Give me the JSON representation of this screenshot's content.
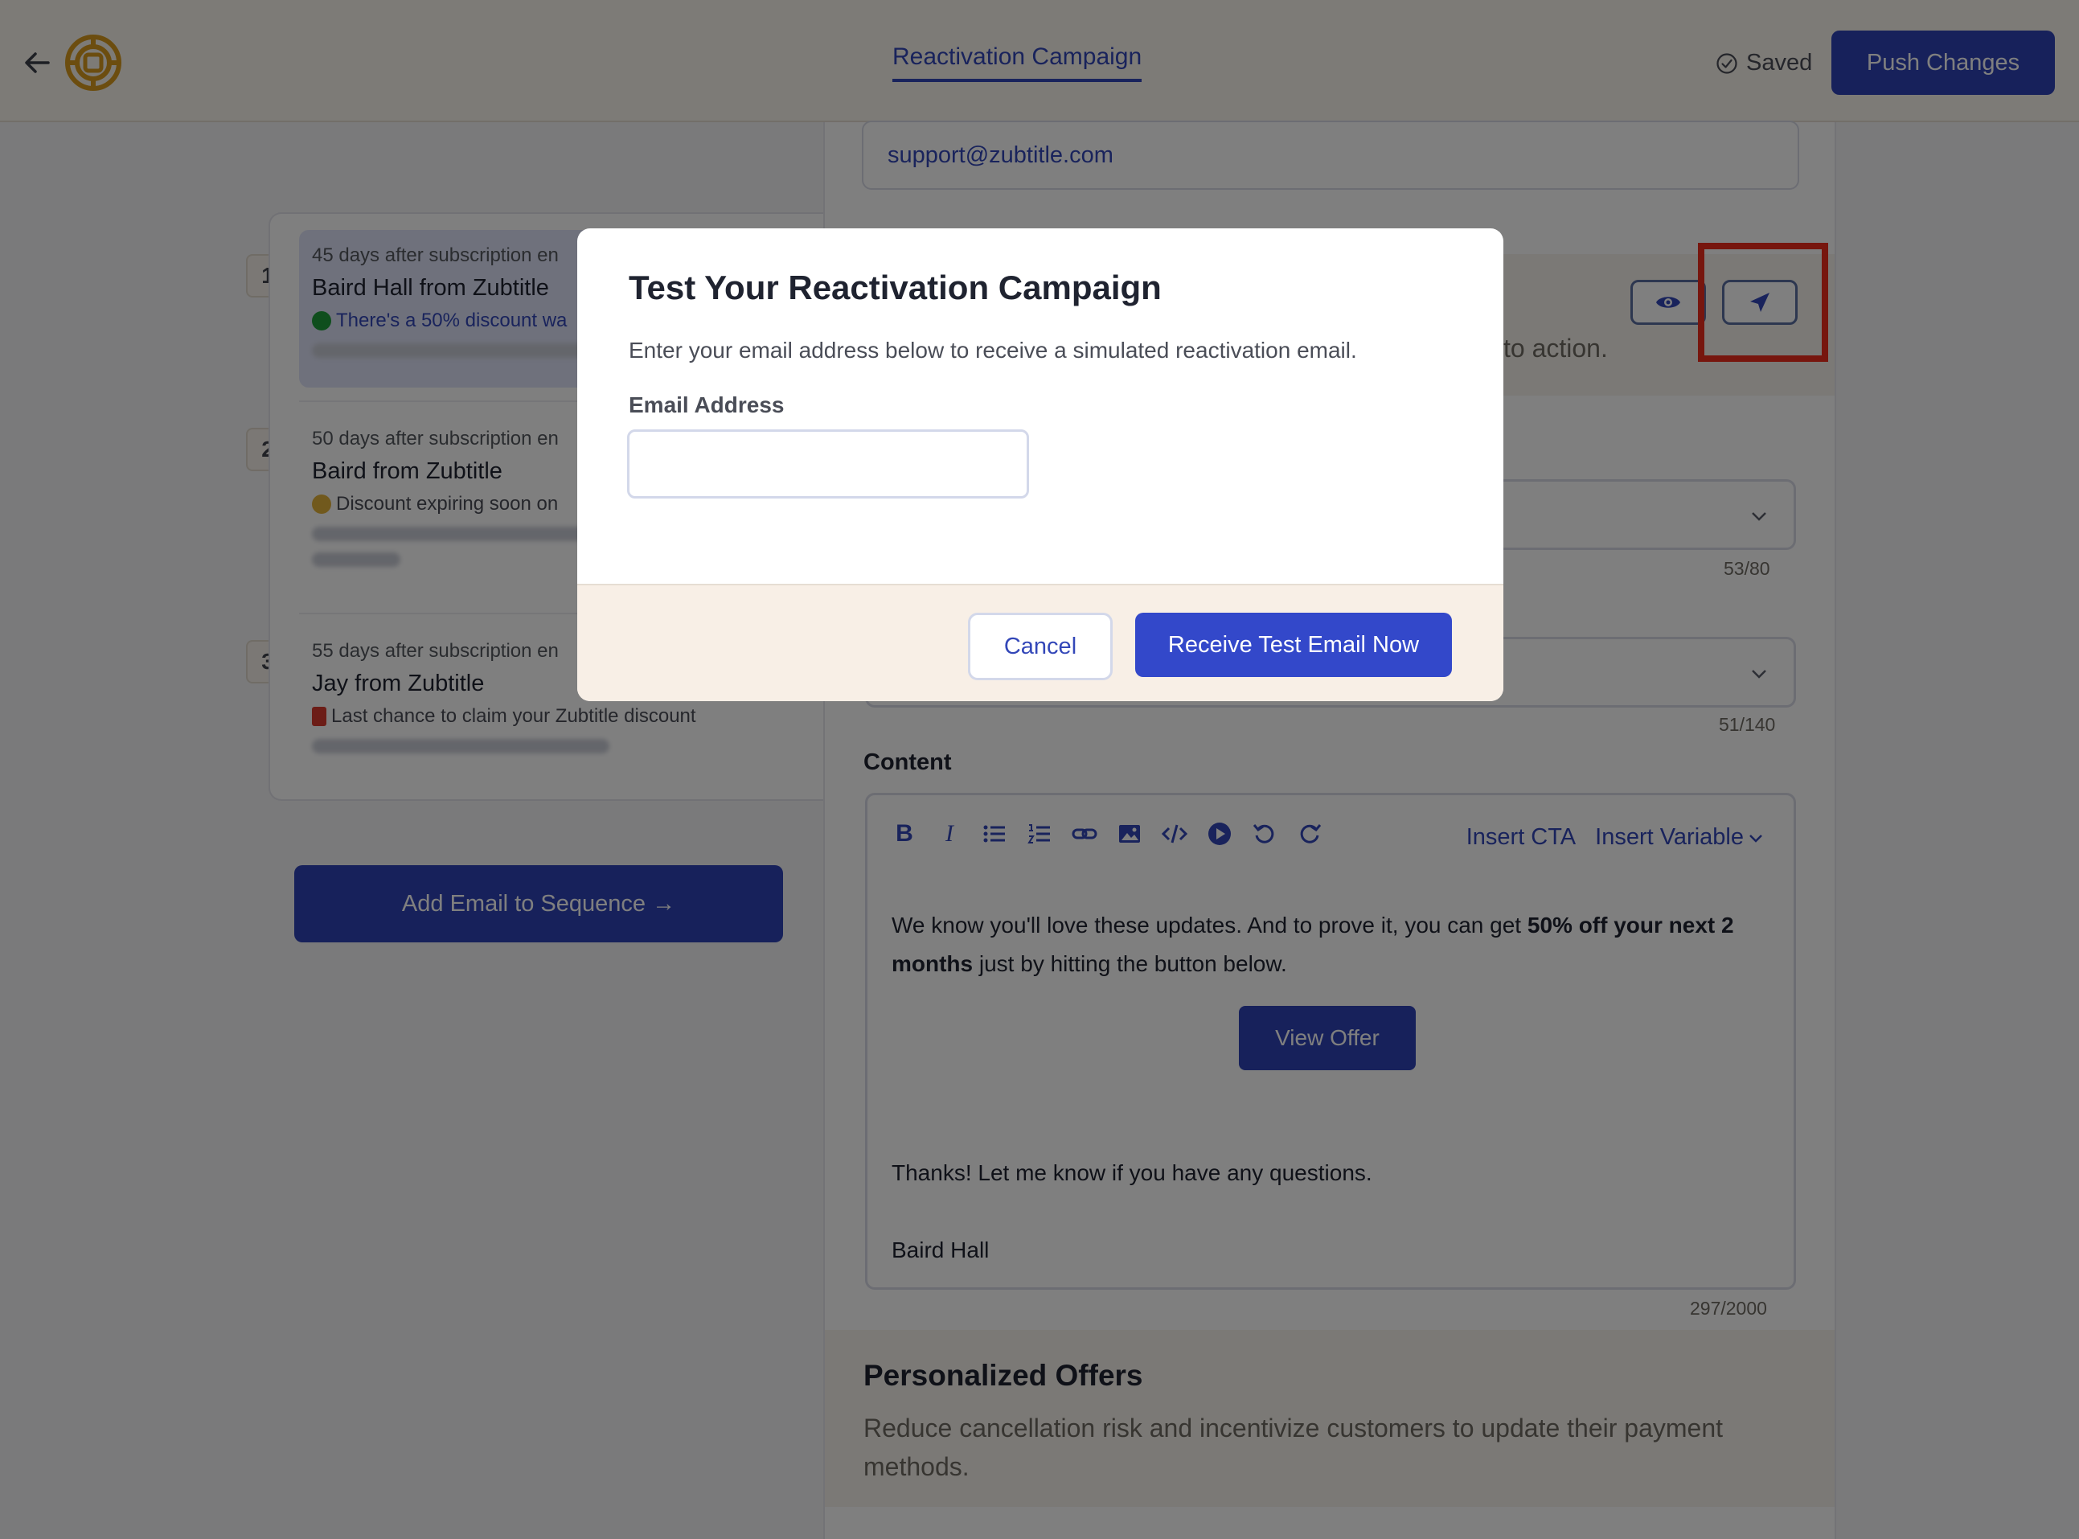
{
  "header": {
    "campaign_tab": "Reactivation Campaign",
    "saved_label": "Saved",
    "push_button": "Push Changes"
  },
  "sequence": {
    "steps": [
      {
        "number": "1",
        "timing": "45 days after subscription en",
        "sender": "Baird Hall from Zubtitle",
        "subject": "There's a 50% discount wa",
        "status_color": "#1f9d3a"
      },
      {
        "number": "2",
        "timing": "50 days after subscription en",
        "sender": "Baird from Zubtitle",
        "subject": "Discount expiring soon on",
        "status_color": "#e2b23a"
      },
      {
        "number": "3",
        "timing": "55 days after subscription en",
        "sender": "Jay from Zubtitle",
        "subject": "Last chance to claim your Zubtitle discount",
        "status_color": "#d83a2e"
      }
    ],
    "add_button": "Add Email to Sequence →"
  },
  "editor": {
    "from_email": "support@zubtitle.com",
    "strip_text": "to action.",
    "preview_icon": "eye-icon",
    "send_test_icon": "paper-plane-icon",
    "subject_counter": "53/80",
    "preview_counter": "51/140",
    "content_label": "Content",
    "toolbar_icons": [
      "bold-icon",
      "italic-icon",
      "bullet-list-icon",
      "numbered-list-icon",
      "link-icon",
      "image-icon",
      "code-icon",
      "video-icon",
      "undo-icon",
      "redo-icon"
    ],
    "insert_cta": "Insert CTA",
    "insert_variable": "Insert Variable",
    "body_pre": "We know you'll love these updates. And to prove it, you can get ",
    "body_bold": "50% off your next 2 months",
    "body_post": " just by hitting the button below.",
    "cta_button": "View Offer",
    "thanks_line": "Thanks! Let me know if you have any questions.",
    "signature": "Baird Hall",
    "content_counter": "297/2000"
  },
  "offers": {
    "title": "Personalized Offers",
    "description": "Reduce cancellation risk and incentivize customers to update their payment methods."
  },
  "modal": {
    "title": "Test Your Reactivation Campaign",
    "description": "Enter your email address below to receive a simulated reactivation email.",
    "email_label": "Email Address",
    "email_value": "",
    "email_placeholder": "",
    "cancel_button": "Cancel",
    "receive_button": "Receive Test Email Now"
  },
  "colors": {
    "accent": "#2f43b7",
    "highlight": "#ee2c1c"
  }
}
